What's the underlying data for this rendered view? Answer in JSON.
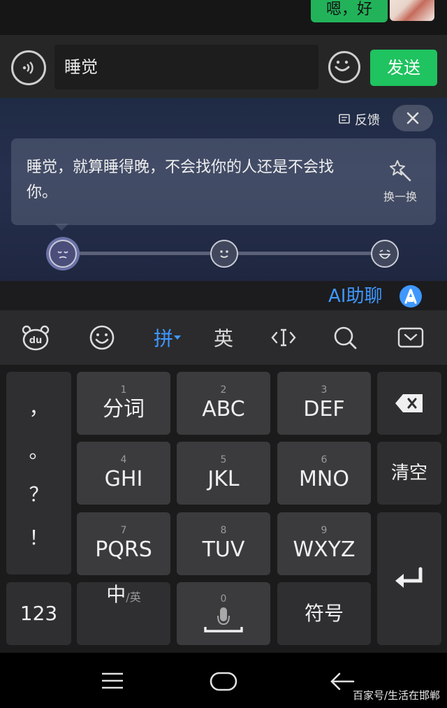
{
  "chat": {
    "bubble_text": "嗯，好"
  },
  "input_bar": {
    "field_value": "睡觉",
    "send_label": "发送"
  },
  "ai_panel": {
    "feedback_label": "反馈",
    "suggestion_text": "睡觉，就算睡得晚，不会找你的人还是不会找你。",
    "swap_label": "换一换"
  },
  "ai_chat": {
    "label": "AI助聊"
  },
  "toolbar": {
    "pinyin_label": "拼",
    "english_label": "英"
  },
  "keyboard": {
    "punct": [
      "，",
      "。",
      "？",
      "！"
    ],
    "keys": [
      {
        "num": "1",
        "label": "分词"
      },
      {
        "num": "2",
        "label": "ABC"
      },
      {
        "num": "3",
        "label": "DEF"
      },
      {
        "num": "4",
        "label": "GHI"
      },
      {
        "num": "5",
        "label": "JKL"
      },
      {
        "num": "6",
        "label": "MNO"
      },
      {
        "num": "7",
        "label": "PQRS"
      },
      {
        "num": "8",
        "label": "TUV"
      },
      {
        "num": "9",
        "label": "WXYZ"
      }
    ],
    "clear_label": "清空",
    "num_switch_label": "123",
    "lang_main": "中",
    "lang_sub": "/英",
    "space_num": "0",
    "symbol_label": "符号"
  },
  "watermark": "百家号/生活在邯郸",
  "colors": {
    "send_green": "#1fc35f",
    "ai_blue": "#3f98ff"
  }
}
